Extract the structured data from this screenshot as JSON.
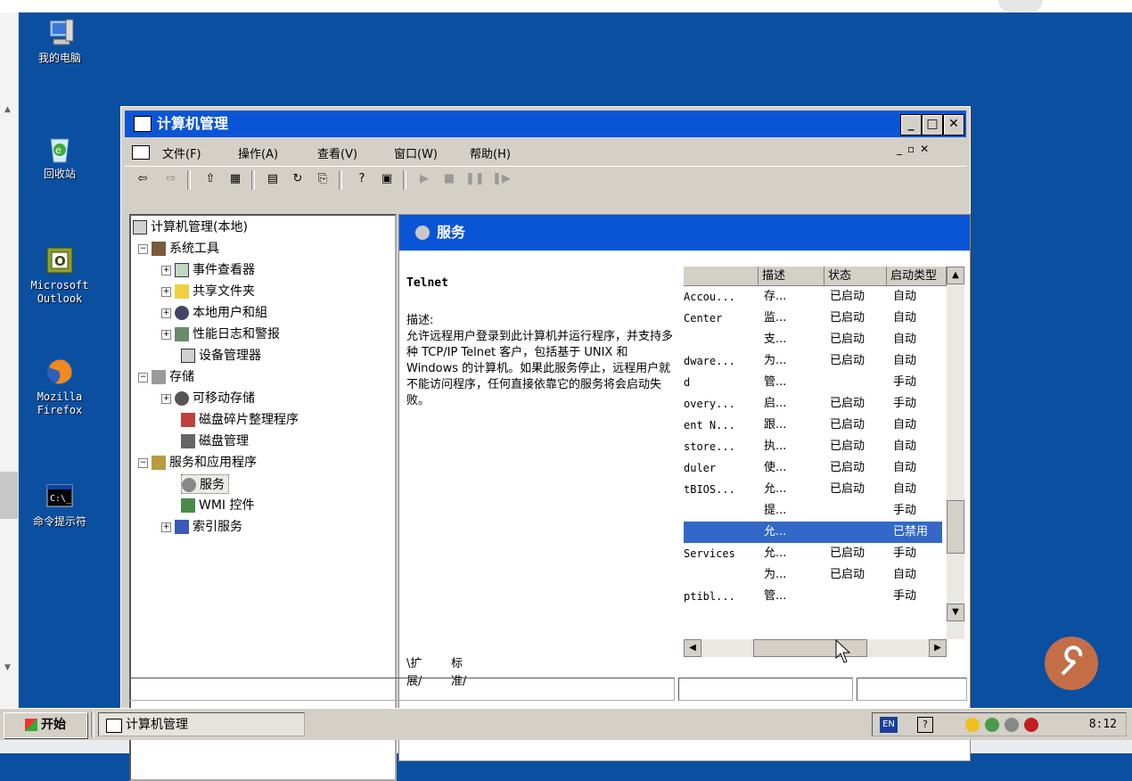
{
  "desktop": {
    "icons": [
      {
        "label": "我的电脑",
        "icon": "my-computer-icon"
      },
      {
        "label": "回收站",
        "icon": "recycle-bin-icon"
      },
      {
        "label": "Microsoft\nOutlook",
        "icon": "outlook-icon"
      },
      {
        "label": "Mozilla\nFirefox",
        "icon": "firefox-icon"
      },
      {
        "label": "命令提示符",
        "icon": "cmd-icon"
      }
    ]
  },
  "window": {
    "title": "计算机管理",
    "menu": [
      "文件(F)",
      "操作(A)",
      "查看(V)",
      "窗口(W)",
      "帮助(H)"
    ],
    "tree": {
      "root": "计算机管理(本地)",
      "system_tools": "系统工具",
      "event_viewer": "事件查看器",
      "shared_folders": "共享文件夹",
      "local_users": "本地用户和組",
      "perf_logs": "性能日志和警报",
      "device_manager": "设备管理器",
      "storage": "存储",
      "removable": "可移动存储",
      "defrag": "磁盘碎片整理程序",
      "disk_mgmt": "磁盘管理",
      "services_apps": "服务和应用程序",
      "services": "服务",
      "wmi": "WMI 控件",
      "indexing": "索引服务"
    },
    "pane_title": "服务",
    "selected_service": "Telnet",
    "description_label": "描述:",
    "description": "允许远程用户登录到此计算机并运行程序，并支持多种 TCP/IP Telnet 客户，包括基于 UNIX 和 Windows 的计算机。如果此服务停止，远程用户就不能访问程序，任何直接依靠它的服务将会启动失败。",
    "columns": [
      "",
      "描述",
      "状态",
      "启动类型"
    ],
    "rows": [
      [
        "Accou...",
        "存...",
        "已启动",
        "自动"
      ],
      [
        "Center",
        "监...",
        "已启动",
        "自动"
      ],
      [
        "",
        "支...",
        "已启动",
        "自动"
      ],
      [
        "dware...",
        "为...",
        "已启动",
        "自动"
      ],
      [
        "d",
        "管...",
        "",
        "手动"
      ],
      [
        "overy...",
        "启...",
        "已启动",
        "手动"
      ],
      [
        "ent N...",
        "跟...",
        "已启动",
        "自动"
      ],
      [
        "store...",
        "执...",
        "已启动",
        "自动"
      ],
      [
        "duler",
        "使...",
        "已启动",
        "自动"
      ],
      [
        "tBIOS...",
        "允...",
        "已启动",
        "自动"
      ],
      [
        "",
        "提...",
        "",
        "手动"
      ],
      [
        "",
        "允...",
        "",
        "已禁用"
      ],
      [
        "Services",
        "允...",
        "已启动",
        "手动"
      ],
      [
        "",
        "为...",
        "已启动",
        "自动"
      ],
      [
        "ptibl...",
        "管...",
        "",
        "手动"
      ]
    ],
    "selected_row": 11,
    "tabs": [
      "扩展",
      "标准"
    ]
  },
  "taskbar": {
    "start": "开始",
    "task": "计算机管理",
    "lang": "EN",
    "time": "8:12"
  }
}
